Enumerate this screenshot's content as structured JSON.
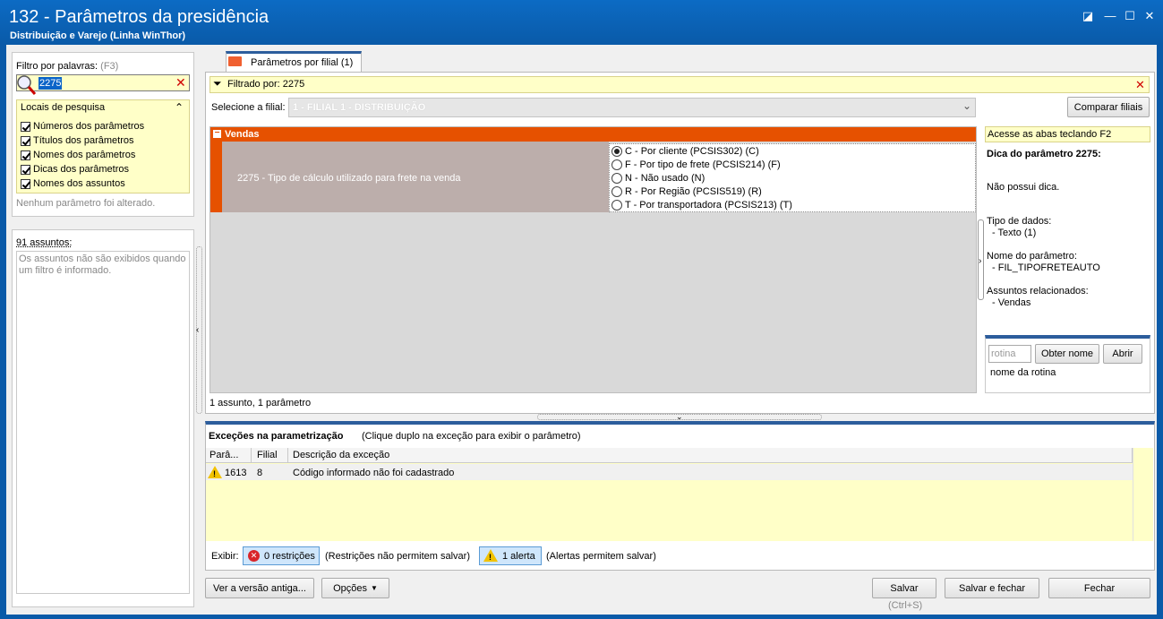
{
  "window": {
    "title": "132 - Parâmetros da presidência",
    "subtitle": "Distribuição e Varejo (Linha WinThor)"
  },
  "filter": {
    "label": "Filtro por palavras:",
    "shortcut": "(F3)",
    "value": "2275",
    "locais_title": "Locais de pesquisa",
    "locais": [
      "Números dos parâmetros",
      "Títulos dos parâmetros",
      "Nomes dos parâmetros",
      "Dicas dos parâmetros",
      "Nomes dos assuntos"
    ],
    "no_change": "Nenhum parâmetro foi alterado."
  },
  "assuntos": {
    "count": "91 assuntos:",
    "message": "Os assuntos não são exibidos quando um filtro é informado."
  },
  "tab": {
    "label": "Parâmetros por filial",
    "count": "(1)"
  },
  "main": {
    "filtered_by": "Filtrado por: 2275",
    "filial_label": "Selecione a filial:",
    "filial_value": "1 - FILIAL 1 - DISTRIBUIÇÃO",
    "compare_button": "Comparar filiais",
    "group_label": "Vendas",
    "param_desc": "2275 - Tipo de cálculo utilizado para frete na venda",
    "options": [
      {
        "label": "C - Por cliente (PCSIS302) (C)",
        "selected": true
      },
      {
        "label": "F - Por tipo de frete (PCSIS214) (F)",
        "selected": false
      },
      {
        "label": "N - Não usado (N)",
        "selected": false
      },
      {
        "label": "R - Por Região (PCSIS519) (R)",
        "selected": false
      },
      {
        "label": "T - Por transportadora (PCSIS213) (T)",
        "selected": false
      }
    ],
    "status": "1 assunto, 1 parâmetro"
  },
  "hint": {
    "access": "Acesse as abas teclando F2",
    "dica_title": "Dica do parâmetro 2275:",
    "dica_text": "Não possui dica.",
    "tipo_label": "Tipo de dados:",
    "tipo_value": "- Texto (1)",
    "nome_label": "Nome do parâmetro:",
    "nome_value": "- FIL_TIPOFRETEAUTO",
    "assunto_label": "Assuntos relacionados:",
    "assunto_value": "- Vendas"
  },
  "rotina": {
    "placeholder": "rotina",
    "obter_button": "Obter nome",
    "abrir_button": "Abrir",
    "name_label": "nome da rotina"
  },
  "exceptions": {
    "title": "Exceções na parametrização",
    "hint": "(Clique duplo na exceção para exibir o parâmetro)",
    "columns": [
      "Parâ...",
      "Filial",
      "Descrição da exceção"
    ],
    "rows": [
      {
        "param": "1613",
        "filial": "8",
        "descricao": "Código informado não foi cadastrado"
      }
    ],
    "exibir_label": "Exibir:",
    "restricoes_button": "0 restrições",
    "restricoes_note": "(Restrições não permitem salvar)",
    "alertas_button": "1 alerta",
    "alertas_note": "(Alertas permitem salvar)"
  },
  "footer": {
    "antiga_button": "Ver a versão antiga...",
    "opcoes_button": "Opções",
    "salvar_button": "Salvar",
    "salvar_shortcut": "(Ctrl+S)",
    "salvar_fechar_button": "Salvar e fechar",
    "fechar_button": "Fechar"
  },
  "colors": {
    "titlebar": "#0a5aa8",
    "accent": "#e65100",
    "highlight": "#ffffc8"
  }
}
